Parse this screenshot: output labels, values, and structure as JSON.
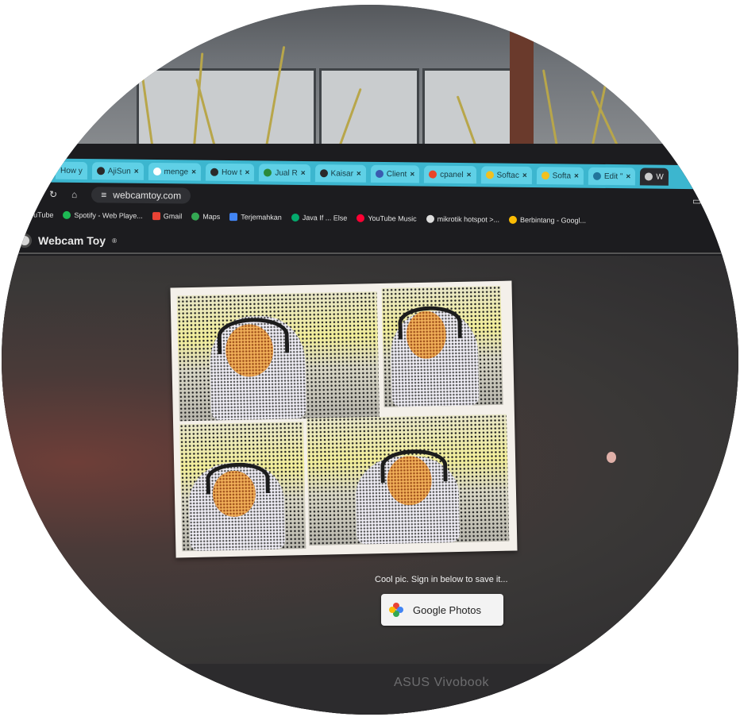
{
  "tabs": [
    {
      "title": "How y"
    },
    {
      "title": "AjiSun"
    },
    {
      "title": "menge"
    },
    {
      "title": "How t"
    },
    {
      "title": "Jual R"
    },
    {
      "title": "Kaisar"
    },
    {
      "title": "Client"
    },
    {
      "title": "cpanel"
    },
    {
      "title": "Softac"
    },
    {
      "title": "Softa"
    },
    {
      "title": "Edit \""
    },
    {
      "title": "W"
    }
  ],
  "address": {
    "url": "webcamtoy.com"
  },
  "bookmarks": [
    {
      "label": "YouTube",
      "color": "#ff0000"
    },
    {
      "label": "Spotify - Web Playe...",
      "color": "#1db954"
    },
    {
      "label": "Gmail",
      "color": "#ea4335"
    },
    {
      "label": "Maps",
      "color": "#34a853"
    },
    {
      "label": "Terjemahkan",
      "color": "#4285f4"
    },
    {
      "label": "Java If ... Else",
      "color": "#04aa6d"
    },
    {
      "label": "YouTube Music",
      "color": "#ff0033"
    },
    {
      "label": "mikrotik hotspot >...",
      "color": "#dddddd"
    },
    {
      "label": "Berbintang - Googl...",
      "color": "#fbbc04"
    }
  ],
  "app": {
    "title": "Webcam Toy",
    "trademark": "®"
  },
  "save": {
    "caption": "Cool pic. Sign in below to save it...",
    "button_label": "Google Photos"
  },
  "device": {
    "brand": "ASUS Vivobook"
  }
}
